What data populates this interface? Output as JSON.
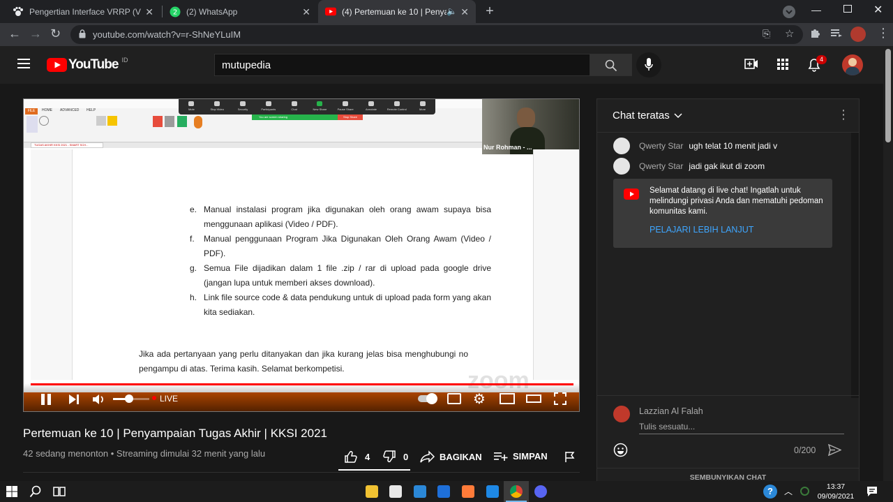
{
  "browser": {
    "tabs": [
      {
        "title": "Pengertian Interface VRRP (Virtu",
        "icon": "paw-icon",
        "active": false
      },
      {
        "title": "(2) WhatsApp",
        "icon": "whatsapp-icon",
        "active": false
      },
      {
        "title": "(4) Pertemuan ke 10 | Penyan",
        "icon": "youtube-icon",
        "active": true
      }
    ],
    "new_tab": "+",
    "url": "youtube.com/watch?v=r-ShNeYLuIM"
  },
  "youtube": {
    "logo_text": "YouTube",
    "country": "ID",
    "search_value": "mutupedia",
    "notification_count": "4"
  },
  "player": {
    "zoom_toolbar": [
      "Mute",
      "Stop Video",
      "Security",
      "Participants",
      "Chat",
      "New Share",
      "Pause Share",
      "Annotate",
      "Remote Control",
      "More"
    ],
    "participants_count": "118",
    "sharing_banner": "You are screen sharing",
    "stop_share": "Stop Share",
    "webcam_name": "Nur Rohman - ...",
    "app_tabs": [
      "FILE",
      "HOME",
      "ADVANCED",
      "HELP"
    ],
    "doc_tab": "TUGAS AKHIR KKSI 2021 - SMART SCH...",
    "doc_items": [
      {
        "marker": "e.",
        "text": "Manual instalasi program jika digunakan oleh orang awam supaya bisa menggunaan aplikasi (Video / PDF)."
      },
      {
        "marker": "f.",
        "text": "Manual penggunaan Program Jika Digunakan Oleh Orang Awam (Video / PDF)."
      },
      {
        "marker": "g.",
        "text": "Semua File dijadikan dalam 1 file .zip / rar di upload pada google drive (jangan lupa untuk memberi akses download)."
      },
      {
        "marker": "h.",
        "text": "Link file source code & data pendukung untuk di upload pada form yang akan kita sediakan."
      }
    ],
    "doc_closing": "Jika ada pertanyaan yang perlu ditanyakan dan jika kurang jelas bisa menghubungi no pengampu di atas. Terima kasih. Selamat berkompetisi.",
    "watermark": "zoom",
    "live_label": "LIVE",
    "progress": 1.0,
    "volume": 0.45
  },
  "video": {
    "title": "Pertemuan ke 10 | Penyampaian Tugas Akhir | KKSI 2021",
    "meta": "42 sedang menonton • Streaming dimulai 32 menit yang lalu",
    "likes": "4",
    "dislikes": "0",
    "share": "BAGIKAN",
    "save": "SIMPAN"
  },
  "chat": {
    "header": "Chat teratas",
    "messages": [
      {
        "author": "Qwerty Star",
        "text": "ugh telat 10 menit jadi v"
      },
      {
        "author": "Qwerty Star",
        "text": "jadi gak ikut di zoom"
      }
    ],
    "notice": "Selamat datang di live chat! Ingatlah untuk melindungi privasi Anda dan mematuhi pedoman komunitas kami.",
    "notice_link": "PELAJARI LEBIH LANJUT",
    "user": "Lazzian Al Falah",
    "input_placeholder": "Tulis sesuatu...",
    "char_count": "0/200",
    "hide": "SEMBUNYIKAN CHAT"
  },
  "taskbar": {
    "time": "13:37",
    "date": "09/09/2021"
  },
  "colors": {
    "yt_red": "#ff0000",
    "zoom_green": "#26b34b",
    "link_blue": "#3ea6ff"
  }
}
